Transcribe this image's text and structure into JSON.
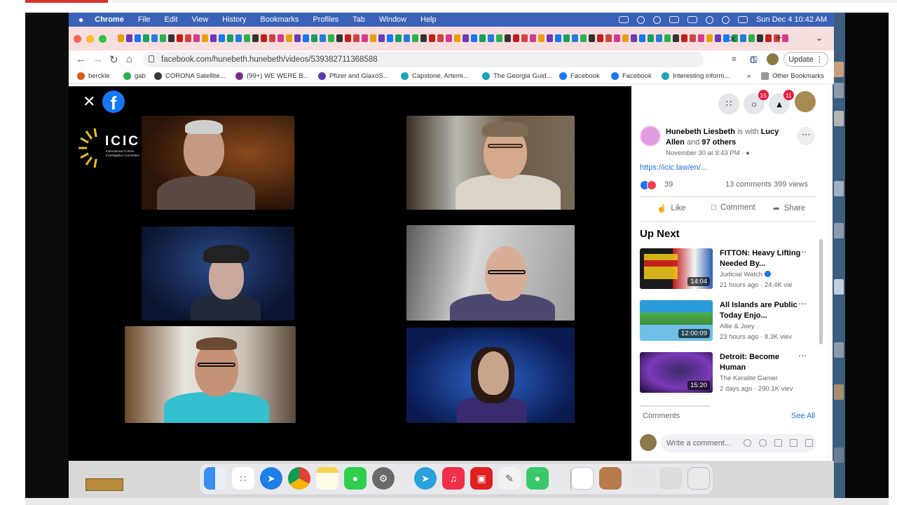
{
  "menubar": {
    "items": [
      "Chrome",
      "File",
      "Edit",
      "View",
      "History",
      "Bookmarks",
      "Profiles",
      "Tab",
      "Window",
      "Help"
    ],
    "datetime": "Sun Dec 4  10:42 AM"
  },
  "toolbar": {
    "url": "facebook.com/hunebeth.hunebeth/videos/539382711368588",
    "update_label": "Update"
  },
  "bookmarks": [
    {
      "label": "berckle",
      "color": "#e05a1a"
    },
    {
      "label": "gab",
      "color": "#2bb24c"
    },
    {
      "label": "CORONA Satellite...",
      "color": "#3a3a3a"
    },
    {
      "label": "(99+) WE WERE B...",
      "color": "#7b2a8c"
    },
    {
      "label": "Pfizer and GlaxoS...",
      "color": "#5b3ab0"
    },
    {
      "label": "Capstone, Artemi...",
      "color": "#1aa3b8"
    },
    {
      "label": "The Georgia Guid...",
      "color": "#1aa3b8"
    },
    {
      "label": "Facebook",
      "color": "#1877f2"
    },
    {
      "label": "Facebook",
      "color": "#1877f2"
    },
    {
      "label": "Interesting inform...",
      "color": "#1aa3b8"
    }
  ],
  "other_bookmarks": "Other Bookmarks",
  "video": {
    "overlay_logo": "ICIC",
    "overlay_logo_sub": "International Crimes Investigative Committee"
  },
  "panel": {
    "badges": {
      "messenger": "15",
      "notifications": "11"
    },
    "post": {
      "author": "Hunebeth Liesbeth",
      "with_word": "is with",
      "tagged": "Lucy Allen",
      "and_word": "and",
      "others": "97 others",
      "date": "November 30 at 9:43 PM · ",
      "link": "https://icic.law/en/...",
      "reactions": "39",
      "stats": "13 comments  399 views"
    },
    "actions": {
      "like": "Like",
      "comment": "Comment",
      "share": "Share"
    },
    "up_next_title": "Up Next",
    "videos": [
      {
        "title": "FITTON: Heavy Lifting Needed By...",
        "channel": "Judicial Watch",
        "meta": "21 hours ago · 24.4K vie",
        "duration": "14:04",
        "verified": true
      },
      {
        "title": "All Islands are Public Today Enjo...",
        "channel": "Allie & Joey",
        "meta": "23 hours ago · 8.3K viev",
        "duration": "12:00:09",
        "verified": false
      },
      {
        "title": "Detroit: Become Human",
        "channel": "The Keralite Gamer",
        "meta": "2 days ago · 290.1K viev",
        "duration": "15:20",
        "verified": false
      }
    ],
    "comments_label": "Comments",
    "see_all": "See All",
    "comment_placeholder": "Write a comment..."
  },
  "icons": {
    "close": "close-icon",
    "facebook": "facebook-logo-icon",
    "menu": "menu-grid-icon",
    "messenger": "messenger-icon",
    "notifications": "bell-icon"
  }
}
